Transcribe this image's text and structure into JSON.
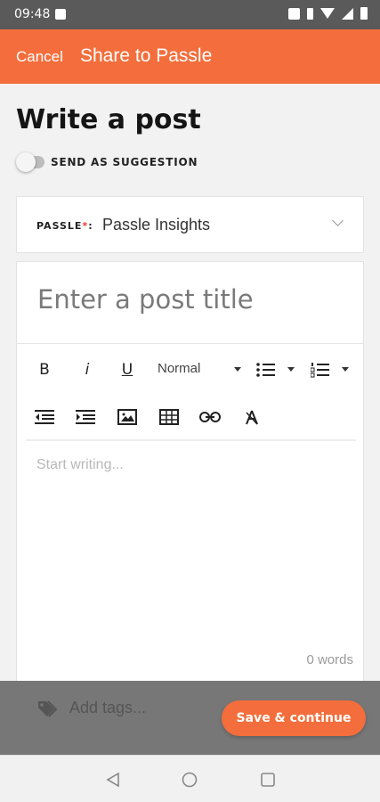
{
  "status_bar": {
    "time": "09:48"
  },
  "app_bar": {
    "cancel_label": "Cancel",
    "title": "Share to Passle"
  },
  "page": {
    "heading": "Write a post"
  },
  "suggestion_toggle": {
    "label": "SEND AS SUGGESTION",
    "checked": false
  },
  "passle_select": {
    "label": "PASSLE",
    "required_mark": "*",
    "colon": ":",
    "selected_value": "Passle Insights"
  },
  "editor": {
    "title_placeholder": "Enter a post title",
    "body_placeholder": "Start writing...",
    "word_count": "0 words",
    "toolbar": {
      "bold_label": "B",
      "italic_label": "i",
      "underline_label": "U",
      "style_selected": "Normal",
      "icons": [
        "bold-icon",
        "italic-icon",
        "underline-icon",
        "bullet-list-icon",
        "numbered-list-icon",
        "outdent-icon",
        "indent-icon",
        "image-icon",
        "table-icon",
        "link-icon",
        "clear-format-icon"
      ]
    }
  },
  "footer": {
    "tags_placeholder": "Add tags...",
    "save_label": "Save & continue"
  },
  "colors": {
    "accent": "#f36e3c",
    "status_bar": "#5a5a5a",
    "overlay": "#777777"
  }
}
